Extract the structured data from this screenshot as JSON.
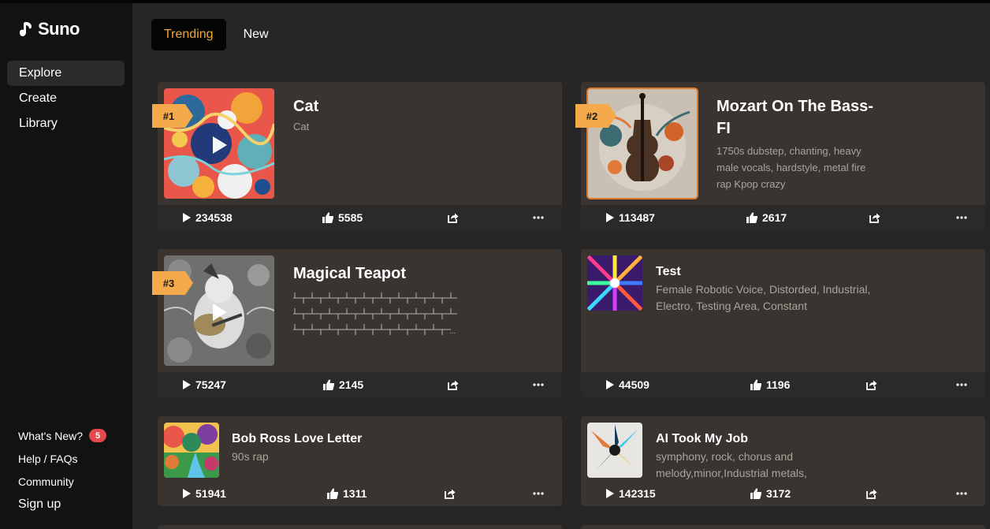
{
  "app": {
    "name": "Suno"
  },
  "sidebar": {
    "nav": [
      {
        "label": "Explore",
        "active": true
      },
      {
        "label": "Create",
        "active": false
      },
      {
        "label": "Library",
        "active": false
      }
    ],
    "footer": {
      "whats_new": "What's New?",
      "whats_new_badge": "5",
      "help": "Help / FAQs",
      "community": "Community",
      "signup": "Sign up"
    }
  },
  "tabs": [
    {
      "label": "Trending",
      "active": true
    },
    {
      "label": "New",
      "active": false
    }
  ],
  "songs": [
    {
      "rank": "#1",
      "title": "Cat",
      "description": "Cat",
      "plays": "234538",
      "likes": "5585"
    },
    {
      "rank": "#2",
      "title": "Mozart On The Bass-",
      "title_line2": "FI",
      "description": "1750s dubstep, chanting, heavy",
      "description_line2": "male vocals, hardstyle, metal fire",
      "description_line3": "rap Kpop crazy",
      "plays": "113487",
      "likes": "2617"
    },
    {
      "rank": "#3",
      "title": "Magical Teapot",
      "description": "",
      "plays": "75247",
      "likes": "2145"
    },
    {
      "title": "Test",
      "description": "Female Robotic Voice, Distorded, Industrial,",
      "description_line2": "Electro, Testing Area, Constant",
      "plays": "44509",
      "likes": "1196"
    },
    {
      "title": "Bob Ross Love Letter",
      "description": "90s rap",
      "plays": "51941",
      "likes": "1311"
    },
    {
      "title": "AI Took My Job",
      "description": "symphony, rock, chorus and",
      "description_line2": "melody,minor,Industrial metals,",
      "plays": "142315",
      "likes": "3172"
    }
  ],
  "colors": {
    "accent": "#f0a93a",
    "rank_badge": "#f4a94a",
    "card": "#3a3430",
    "stats_bar": "#2c2a28",
    "badge": "#e5484d"
  },
  "icons": [
    "play-icon",
    "thumbs-up-icon",
    "share-icon",
    "more-icon"
  ]
}
